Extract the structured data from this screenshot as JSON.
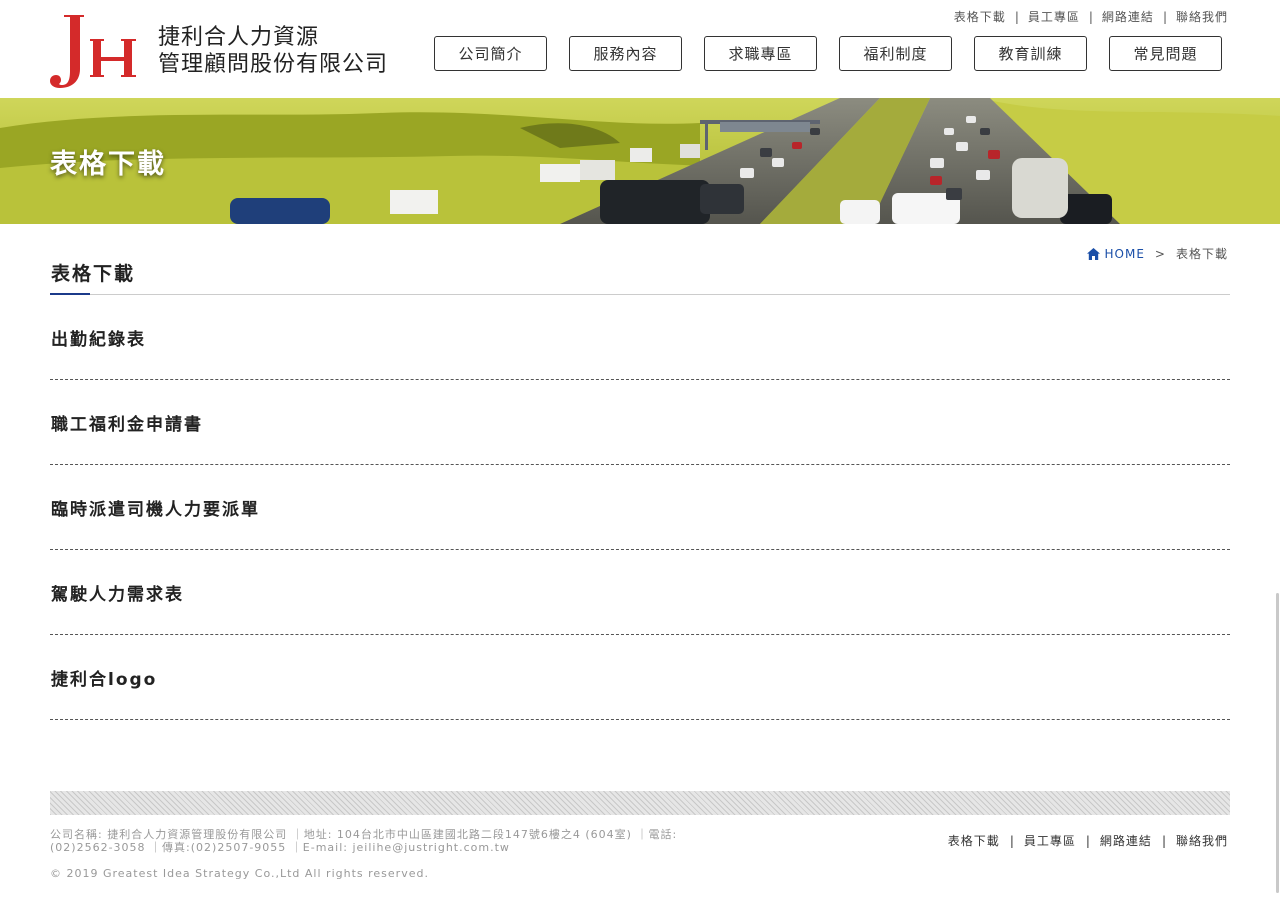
{
  "brand": {
    "line1": "捷利合人力資源",
    "line2": "管理顧問股份有限公司",
    "logo_letters": "JH",
    "logo_colors": {
      "j": "#d42a2a",
      "h": "#d42a2a"
    }
  },
  "top_links": [
    {
      "label": "表格下載"
    },
    {
      "label": "員工專區"
    },
    {
      "label": "網路連結"
    },
    {
      "label": "聯絡我們"
    }
  ],
  "separator": "|",
  "nav": [
    {
      "label": "公司簡介"
    },
    {
      "label": "服務內容"
    },
    {
      "label": "求職專區"
    },
    {
      "label": "福利制度"
    },
    {
      "label": "教育訓練"
    },
    {
      "label": "常見問題"
    }
  ],
  "banner": {
    "title": "表格下載"
  },
  "breadcrumb": {
    "home": "HOME",
    "arrow": ">",
    "current": "表格下載"
  },
  "section": {
    "title": "表格下載"
  },
  "downloads": [
    {
      "label": "出勤紀錄表"
    },
    {
      "label": "職工福利金申請書"
    },
    {
      "label": "臨時派遣司機人力要派單"
    },
    {
      "label": "駕駛人力需求表"
    },
    {
      "label": "捷利合logo"
    }
  ],
  "footer": {
    "info": "公司名稱: 捷利合人力資源管理股份有限公司 ｜地址: 104台北市中山區建國北路二段147號6樓之4 (604室) ｜電話: (02)2562-3058 ｜傳真:(02)2507-9055 ｜E-mail: jeilihe@justright.com.tw",
    "copyright": "© 2019 Greatest Idea Strategy Co.,Ltd All rights reserved.",
    "links": [
      {
        "label": "表格下載"
      },
      {
        "label": "員工專區"
      },
      {
        "label": "網路連結"
      },
      {
        "label": "聯絡我們"
      }
    ]
  },
  "colors": {
    "accent": "#1b3a8a",
    "home_link": "#1b4fa8",
    "logo_red": "#d42a2a"
  },
  "icons": {
    "breadcrumb_home": "home-icon"
  }
}
